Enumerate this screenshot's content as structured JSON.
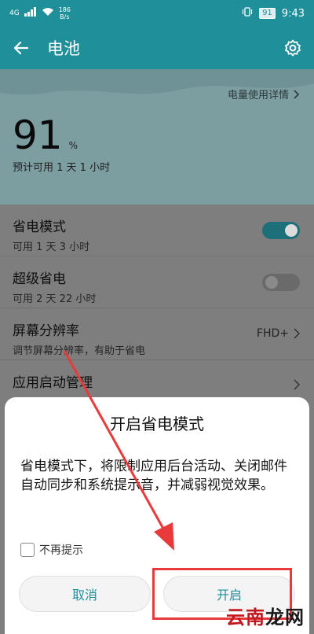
{
  "status_bar": {
    "network_type": "4G",
    "net_speed_value": "186",
    "net_speed_unit": "B/s",
    "battery_level": "91",
    "time": "9:43"
  },
  "app_bar": {
    "title": "电池"
  },
  "battery": {
    "usage_details_link": "电量使用详情",
    "percent": "91",
    "percent_unit": "%",
    "remaining": "预计可用 1 天 1 小时"
  },
  "settings": [
    {
      "title": "省电模式",
      "subtitle": "可用 1 天 3 小时",
      "toggle": "on"
    },
    {
      "title": "超级省电",
      "subtitle": "可用 2 天 22 小时",
      "toggle": "off"
    },
    {
      "title": "屏幕分辨率",
      "subtitle": "调节屏幕分辨率，有助于省电",
      "value": "FHD+"
    },
    {
      "title": "应用启动管理"
    }
  ],
  "dialog": {
    "title": "开启省电模式",
    "body": "省电模式下，将限制应用后台活动、关闭邮件自动同步和系统提示音，并减弱视觉效果。",
    "checkbox_label": "不再提示",
    "cancel_label": "取消",
    "confirm_label": "开启"
  },
  "watermark": {
    "text_red": "云南",
    "text_black": "龙网"
  },
  "colors": {
    "accent": "#1f8f99",
    "annotation": "#e83a3a"
  }
}
